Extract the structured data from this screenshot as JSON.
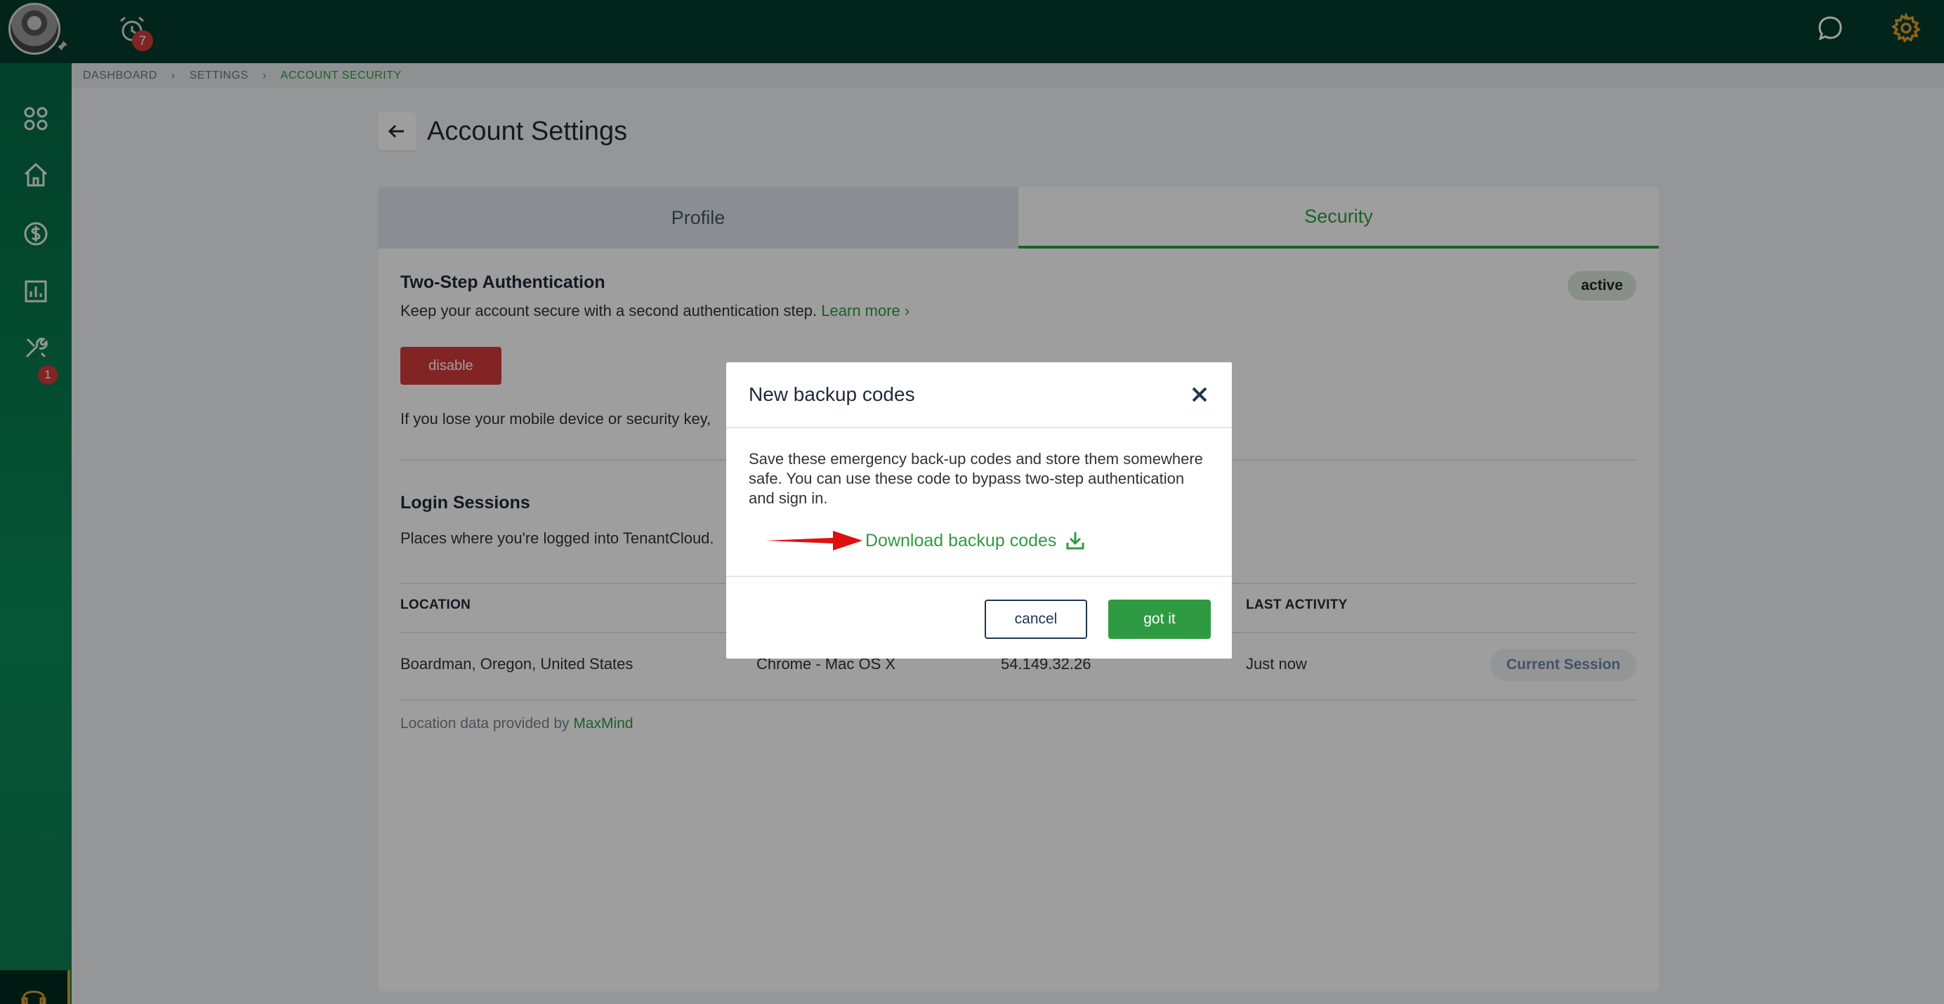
{
  "header": {
    "notification_count": "7"
  },
  "sidebar": {
    "tools_badge_count": "1",
    "items": [
      {
        "icon": "apps-grid-icon"
      },
      {
        "icon": "home-icon"
      },
      {
        "icon": "dollar-icon"
      },
      {
        "icon": "reports-icon"
      },
      {
        "icon": "tools-icon"
      }
    ]
  },
  "breadcrumb": {
    "items": [
      "DASHBOARD",
      "SETTINGS",
      "ACCOUNT SECURITY"
    ]
  },
  "page": {
    "title": "Account Settings"
  },
  "tabs": {
    "profile": "Profile",
    "security": "Security"
  },
  "two_step": {
    "title": "Two-Step Authentication",
    "description": "Keep your account secure with a second authentication step.",
    "learn_more": "Learn more",
    "status": "active",
    "disable_label": "disable",
    "lose_device_text": "If you lose your mobile device or security key,"
  },
  "login_sessions": {
    "title": "Login Sessions",
    "description": "Places where you're logged into TenantCloud.",
    "columns": [
      "LOCATION",
      "LAST ACTIVITY"
    ],
    "rows": [
      {
        "location": "Boardman, Oregon, United States",
        "device": "Chrome - Mac OS X",
        "ip": "54.149.32.26",
        "last_activity": "Just now",
        "badge": "Current Session"
      }
    ],
    "footnote": "Location data provided by",
    "footnote_link": "MaxMind"
  },
  "modal": {
    "title": "New backup codes",
    "body": "Save these emergency back-up codes and store them somewhere safe. You can use these code to bypass two-step authentication and sign in.",
    "download_label": "Download backup codes",
    "cancel_label": "cancel",
    "confirm_label": "got it"
  },
  "colors": {
    "brand_green": "#2e9b42",
    "danger_red": "#d33a3a",
    "topbar": "#033a2c",
    "sidebar": "#0a8a58",
    "arrow_red": "#e01010"
  }
}
